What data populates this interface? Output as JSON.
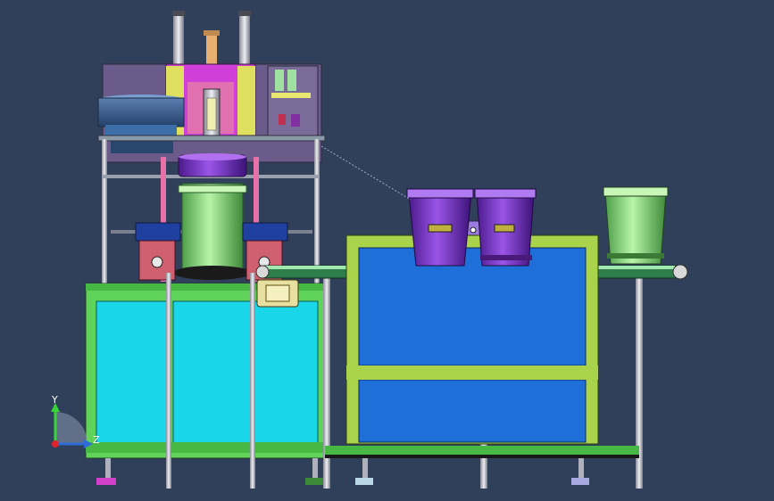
{
  "viewport": {
    "background": "#31405a"
  },
  "triad": {
    "y_label": "Y",
    "z_label": "Z",
    "y_color": "#39d439",
    "z_color": "#2e6bd6",
    "origin_color": "#e0232b"
  },
  "colors": {
    "frame_green": "#5fd35a",
    "frame_yellow_green": "#a8d34a",
    "cabinet_cyan": "#19d6e8",
    "cabinet_blue": "#1f6fd8",
    "purple_bucket": "#7a2fd0",
    "green_bucket": "#82e07a",
    "machine_panel": "#6b5b8a",
    "steel": "#c8c8d2",
    "conveyor": "#2f7d4a"
  },
  "icons": {
    "triad": "coordinate-triad-icon"
  }
}
